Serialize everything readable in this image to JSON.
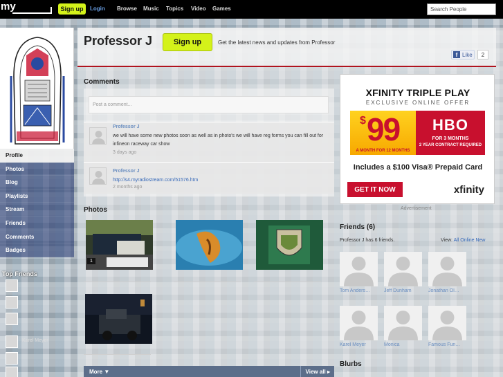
{
  "topnav": {
    "logo": "my",
    "signup_label": "Sign up",
    "login_label": "Login",
    "nav": [
      "Browse",
      "Music",
      "Topics",
      "Video",
      "Games"
    ],
    "search_placeholder": "Search People"
  },
  "sidebar": {
    "items": [
      {
        "label": "Profile",
        "active": true
      },
      {
        "label": "Photos"
      },
      {
        "label": "Blog"
      },
      {
        "label": "Playlists"
      },
      {
        "label": "Stream"
      },
      {
        "label": "Friends"
      },
      {
        "label": "Comments"
      },
      {
        "label": "Badges"
      }
    ],
    "top_friends_title": "Top Friends",
    "top_friends": [
      "",
      "",
      "",
      "Karel Meyer",
      "",
      ""
    ]
  },
  "header": {
    "name": "Professor J",
    "signup_label": "Sign up",
    "tagline": "Get the latest news and updates from Professor",
    "like_label": "Like",
    "like_count": "2"
  },
  "comments": {
    "title": "Comments",
    "input_placeholder": "Post a comment...",
    "items": [
      {
        "author": "Professor J",
        "text": "we will have some new photos soon as well as in photo's we will have reg forms you can fill out for infineon raceway car show",
        "time": "3 days ago"
      },
      {
        "author": "Professor J",
        "text": "http://s4.myradiostream.com/51576.htm",
        "time": "2 months ago"
      }
    ]
  },
  "photos": {
    "title": "Photos",
    "first_count": "1",
    "more_label": "More ▼",
    "view_all_label": "View all ▸"
  },
  "ad": {
    "headline": "XFINITY TRIPLE PLAY",
    "subhead": "EXCLUSIVE ONLINE OFFER",
    "price_symbol": "$",
    "price": "99",
    "price_terms": "A MONTH FOR 12 MONTHS",
    "hbo": "HBO",
    "hbo_terms_1": "FOR 3 MONTHS",
    "hbo_terms_2": "2 YEAR CONTRACT REQUIRED",
    "visa_line": "Includes a $100 Visa® Prepaid Card",
    "cta": "GET IT NOW",
    "brand": "xfinity",
    "caption": "Advertisement"
  },
  "friends": {
    "title": "Friends (6)",
    "count_text": "Professor J has 6 friends.",
    "view_label": "View:",
    "view_all": "All",
    "view_online": "Online",
    "view_new": "New",
    "items": [
      "Tom Anders…",
      "Jeff Dunham",
      "Jonathan Ol…",
      "Karel Meyer",
      "Monica",
      "Famous Fun…"
    ]
  },
  "blurbs": {
    "title": "Blurbs"
  },
  "colors": {
    "signup_green": "#d4f21a",
    "accent_red": "#b0131e",
    "link_blue": "#3568b8"
  }
}
